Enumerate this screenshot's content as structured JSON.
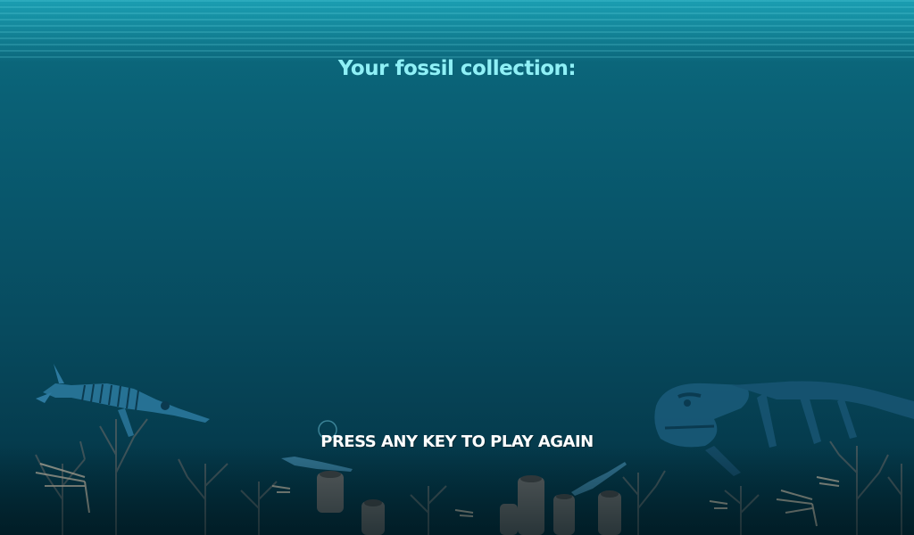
{
  "screen": {
    "title": "Your fossil collection:",
    "prompt": "PRESS ANY KEY TO PLAY AGAIN"
  },
  "colors": {
    "water_top": "#0d6f82",
    "water_bottom": "#022a37",
    "title": "#8ff0f6",
    "prompt": "#ffffff"
  },
  "decor": {
    "left_creature": "ichthyosaur-skeleton",
    "right_creature": "dunkleosteus-fish",
    "seabed": "coral-reef"
  }
}
